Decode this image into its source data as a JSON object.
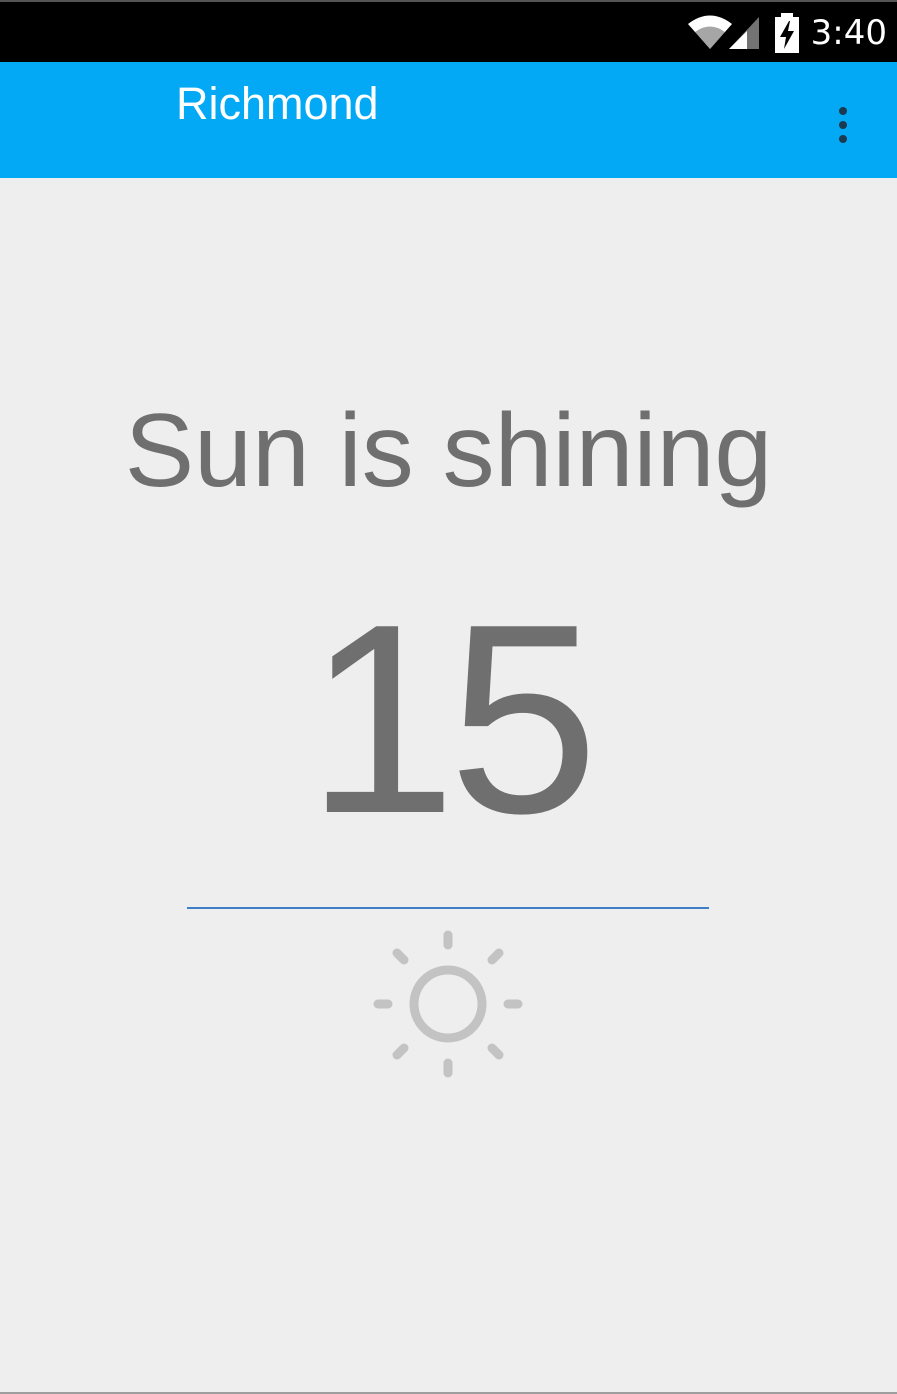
{
  "status_bar": {
    "time": "3:40",
    "icons": [
      "wifi-icon",
      "signal-icon",
      "battery-charging-icon"
    ]
  },
  "app_bar": {
    "title": "Richmond",
    "background_color": "#03a9f4",
    "overflow_icon": "more-vertical-icon"
  },
  "weather": {
    "condition": "Sun is shining",
    "temperature": "15",
    "icon": "sun-icon",
    "text_color": "#6f6f6f",
    "divider_color": "#3f7fc7"
  }
}
